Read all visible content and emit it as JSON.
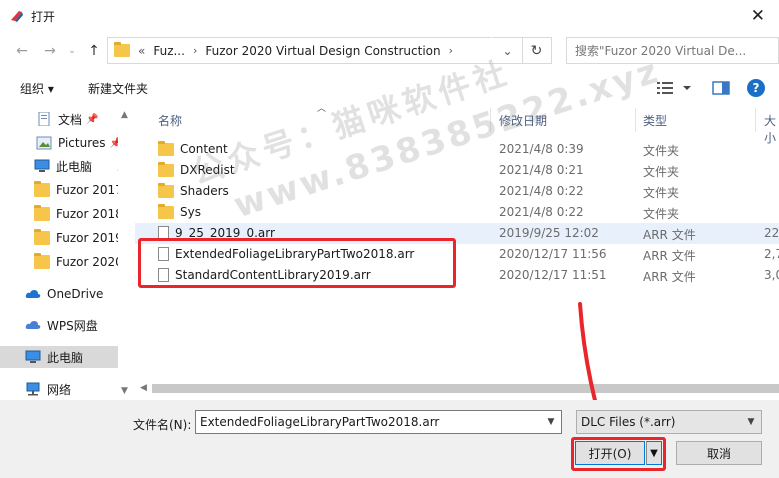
{
  "window": {
    "title": "打开"
  },
  "nav": {
    "breadcrumb": [
      "«",
      "Fuz...",
      "Fuzor 2020 Virtual Design Construction"
    ],
    "search_placeholder": "搜索\"Fuzor 2020 Virtual De..."
  },
  "toolbar": {
    "organize": "组织 ▾",
    "new_folder": "新建文件夹"
  },
  "sidebar": {
    "items": [
      {
        "label": "文档",
        "pinned": true
      },
      {
        "label": "Pictures",
        "pinned": true
      },
      {
        "label": "此电脑",
        "pinned": true
      },
      {
        "label": "Fuzor 2017"
      },
      {
        "label": "Fuzor 2018"
      },
      {
        "label": "Fuzor 2019"
      },
      {
        "label": "Fuzor 2020"
      },
      {
        "label": "OneDrive"
      },
      {
        "label": "WPS网盘"
      },
      {
        "label": "此电脑",
        "selected": true
      },
      {
        "label": "网络"
      }
    ]
  },
  "columns": {
    "name": "名称",
    "date": "修改日期",
    "type": "类型",
    "size": "大小"
  },
  "files": [
    {
      "name": "Content",
      "date": "2021/4/8 0:39",
      "type": "文件夹",
      "size": "",
      "kind": "folder"
    },
    {
      "name": "DXRedist",
      "date": "2021/4/8 0:21",
      "type": "文件夹",
      "size": "",
      "kind": "folder"
    },
    {
      "name": "Shaders",
      "date": "2021/4/8 0:22",
      "type": "文件夹",
      "size": "",
      "kind": "folder"
    },
    {
      "name": "Sys",
      "date": "2021/4/8 0:22",
      "type": "文件夹",
      "size": "",
      "kind": "folder"
    },
    {
      "name": "9_25_2019_0.arr",
      "date": "2019/9/25 12:02",
      "type": "ARR 文件",
      "size": "22",
      "kind": "file"
    },
    {
      "name": "ExtendedFoliageLibraryPartTwo2018.arr",
      "date": "2020/12/17 11:56",
      "type": "ARR 文件",
      "size": "2,7",
      "kind": "file"
    },
    {
      "name": "StandardContentLibrary2019.arr",
      "date": "2020/12/17 11:51",
      "type": "ARR 文件",
      "size": "3,0",
      "kind": "file"
    }
  ],
  "watermark": {
    "line1": "公众号：猫咪软件社",
    "line2": "www.838385222.xyz"
  },
  "bottom": {
    "filename_label": "文件名(N):",
    "filename_value": "ExtendedFoliageLibraryPartTwo2018.arr",
    "filetype_value": "DLC Files (*.arr)",
    "open_label": "打开(O)",
    "cancel_label": "取消"
  },
  "colors": {
    "annotation": "#e8262b",
    "accent": "#0078d7",
    "folder": "#f6c64b"
  }
}
